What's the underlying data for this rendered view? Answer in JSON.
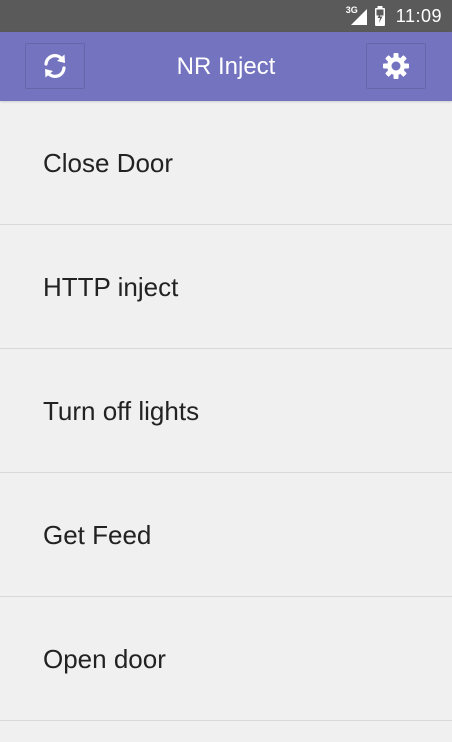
{
  "status_bar": {
    "network": "3G",
    "time": "11:09",
    "background": "#5a5a5a"
  },
  "app_bar": {
    "title": "NR Inject",
    "color": "#7473c0",
    "left_icon": "refresh-icon",
    "right_icon": "gear-icon"
  },
  "list": {
    "items": [
      {
        "label": "Close Door"
      },
      {
        "label": "HTTP inject"
      },
      {
        "label": "Turn off lights"
      },
      {
        "label": "Get Feed"
      },
      {
        "label": "Open door"
      }
    ]
  }
}
